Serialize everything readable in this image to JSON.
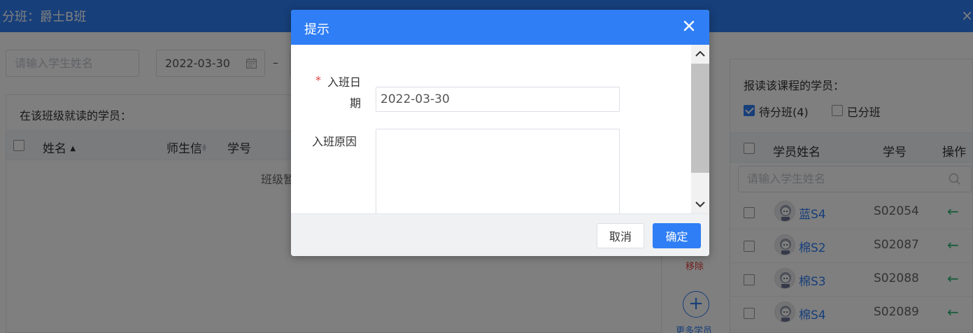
{
  "header": {
    "title": "分班：爵士B班",
    "close_glyph": "×"
  },
  "filters": {
    "student_search_placeholder": "请输入学生姓名",
    "start_date": "2022-03-30",
    "date_separator": "–"
  },
  "enrolled": {
    "title": "在该班级就读的学员：",
    "columns": {
      "name": "姓名",
      "teacher_msg": "师生信",
      "student_no": "学号"
    },
    "sort_indicator": "▲",
    "empty_text": "班级暂"
  },
  "middle_actions": {
    "remove_label": "移除",
    "more_label": "更多学员",
    "add_glyph": "+"
  },
  "course_students": {
    "title": "报读该课程的学员：",
    "filters": [
      {
        "label": "待分班(4)",
        "checked": true
      },
      {
        "label": "已分班",
        "checked": false
      }
    ],
    "columns": {
      "name": "学员姓名",
      "student_no": "学号",
      "action": "操作"
    },
    "search_placeholder": "请输入学生姓名",
    "rows": [
      {
        "name": "蓝S4",
        "id": "S02054"
      },
      {
        "name": "棉S2",
        "id": "S02087"
      },
      {
        "name": "棉S3",
        "id": "S02088"
      },
      {
        "name": "棉S4",
        "id": "S02089"
      }
    ],
    "action_glyph": "←"
  },
  "dialog": {
    "title": "提示",
    "required_mark": "*",
    "date_label_line1": "入班日",
    "date_label_line2": "期",
    "date_value": "2022-03-30",
    "reason_label": "入班原因",
    "reason_value": "",
    "cancel_label": "取消",
    "confirm_label": "确定"
  },
  "colors": {
    "primary": "#2f7ef5",
    "danger": "#e2423d",
    "success": "#2bb673"
  }
}
